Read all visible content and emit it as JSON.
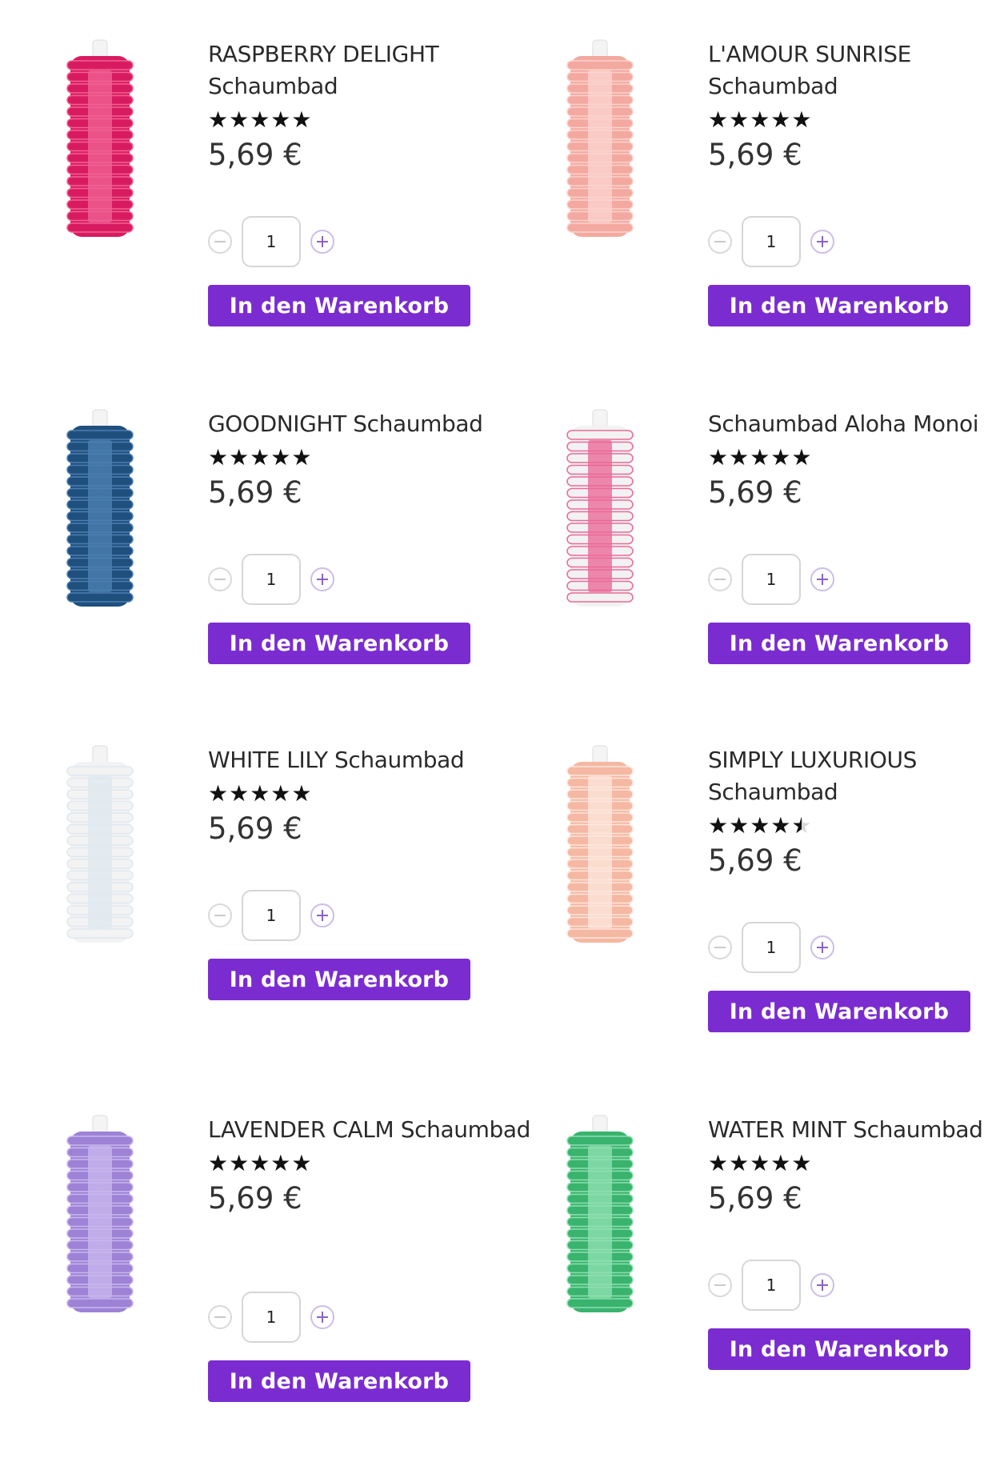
{
  "products": [
    {
      "name": "RASPBERRY DELIGHT Schaumbad",
      "rating": 5,
      "price": "5,69 €",
      "quantity": "1",
      "cart_label": "In den Warenkorb",
      "bottle_color": "#d81b60",
      "bottle_shade": "#f06292"
    },
    {
      "name": "L'AMOUR SUNRISE Schaumbad",
      "rating": 5,
      "price": "5,69 €",
      "quantity": "1",
      "cart_label": "In den Warenkorb",
      "bottle_color": "#f3a9a0",
      "bottle_shade": "#fbd3cd"
    },
    {
      "name": "GOODNIGHT Schaumbad",
      "rating": 5,
      "price": "5,69 €",
      "quantity": "1",
      "cart_label": "In den Warenkorb",
      "bottle_color": "#1f4f7d",
      "bottle_shade": "#4c7fb1"
    },
    {
      "name": "Schaumbad Aloha Monoi",
      "rating": 5,
      "price": "5,69 €",
      "quantity": "1",
      "cart_label": "In den Warenkorb",
      "bottle_color": "#f2f2f2",
      "bottle_shade": "#ea6a98"
    },
    {
      "name": "WHITE LILY Schaumbad",
      "rating": 5,
      "price": "5,69 €",
      "quantity": "1",
      "cart_label": "In den Warenkorb",
      "bottle_color": "#f3f3f3",
      "bottle_shade": "#dfe8f0"
    },
    {
      "name": "SIMPLY LUXURIOUS Schaumbad",
      "rating": 4.5,
      "price": "5,69 €",
      "quantity": "1",
      "cart_label": "In den Warenkorb",
      "bottle_color": "#f5b8a2",
      "bottle_shade": "#fde6dc"
    },
    {
      "name": "LAVENDER CALM Schaumbad",
      "rating": 5,
      "price": "5,69 €",
      "quantity": "1",
      "cart_label": "In den Warenkorb",
      "bottle_color": "#9d82d6",
      "bottle_shade": "#c9b7ee"
    },
    {
      "name": "WATER MINT Schaumbad",
      "rating": 5,
      "price": "5,69 €",
      "quantity": "1",
      "cart_label": "In den Warenkorb",
      "bottle_color": "#39b36e",
      "bottle_shade": "#8fe0b0"
    }
  ],
  "stars_glyph": "★★★★★",
  "icons": {
    "decrease": "minus-circle-icon",
    "increase": "plus-circle-icon"
  },
  "accent_color": "#7b2cd1"
}
